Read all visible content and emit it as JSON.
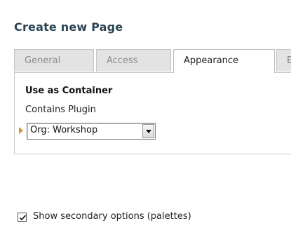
{
  "page": {
    "title": "Create new Page"
  },
  "tabs": [
    {
      "label": "General",
      "active": false
    },
    {
      "label": "Access",
      "active": false
    },
    {
      "label": "Appearance",
      "active": true
    },
    {
      "label": "E",
      "active": false
    }
  ],
  "panel": {
    "heading": "Use as Container",
    "field_label": "Contains Plugin",
    "select": {
      "value": "Org: Workshop"
    }
  },
  "options": {
    "secondary_label": "Show secondary options (palettes)",
    "secondary_checked": true
  },
  "colors": {
    "title": "#2b4454",
    "marker": "#e0922f",
    "tab_inactive": "#e3e3e3",
    "border": "#c6c6c6"
  },
  "icons": {
    "marker": "changed-field-marker",
    "select_arrow": "chevron-down-icon",
    "checkbox": "checkmark-icon"
  }
}
